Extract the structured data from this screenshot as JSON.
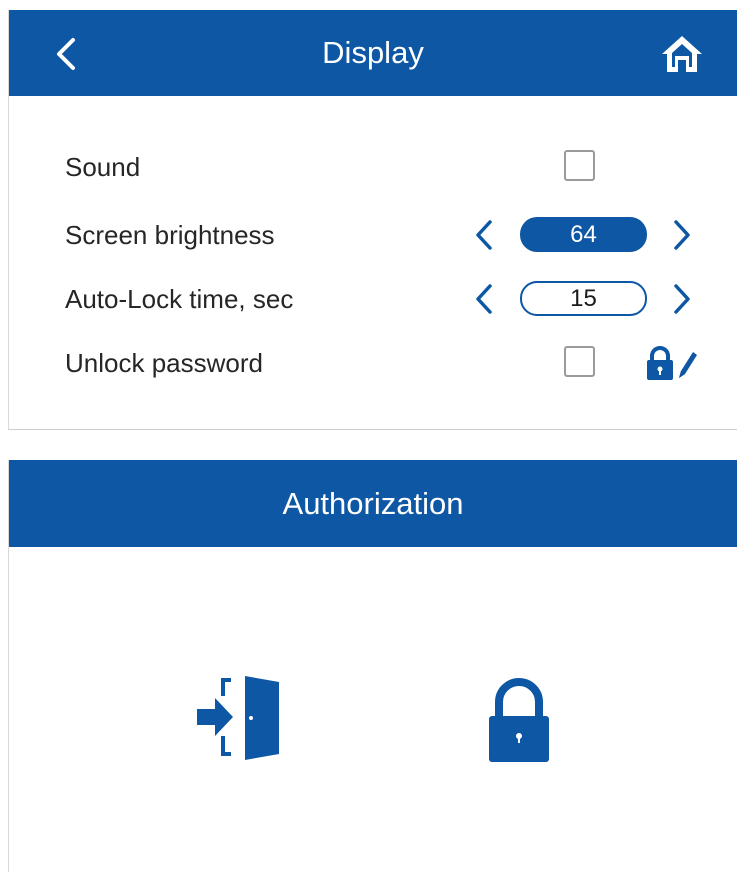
{
  "display": {
    "title": "Display",
    "back_icon": "chevron-left-icon",
    "home_icon": "home-icon",
    "rows": [
      {
        "label": "Sound",
        "control": "checkbox",
        "checked": false
      },
      {
        "label": "Screen brightness",
        "control": "stepper",
        "value": "64",
        "style": "filled"
      },
      {
        "label": "Auto-Lock time, sec",
        "control": "stepper",
        "value": "15",
        "style": "outline"
      },
      {
        "label": "Unlock password",
        "control": "checkbox",
        "checked": false,
        "extra_icon": "lock-edit-icon"
      }
    ]
  },
  "authorization": {
    "title": "Authorization",
    "buttons": [
      {
        "icon": "login-door-icon"
      },
      {
        "icon": "padlock-icon"
      }
    ]
  },
  "colors": {
    "accent": "#0d57a4",
    "header_text": "#ffffff",
    "checkbox_border": "#9a9a9a"
  }
}
